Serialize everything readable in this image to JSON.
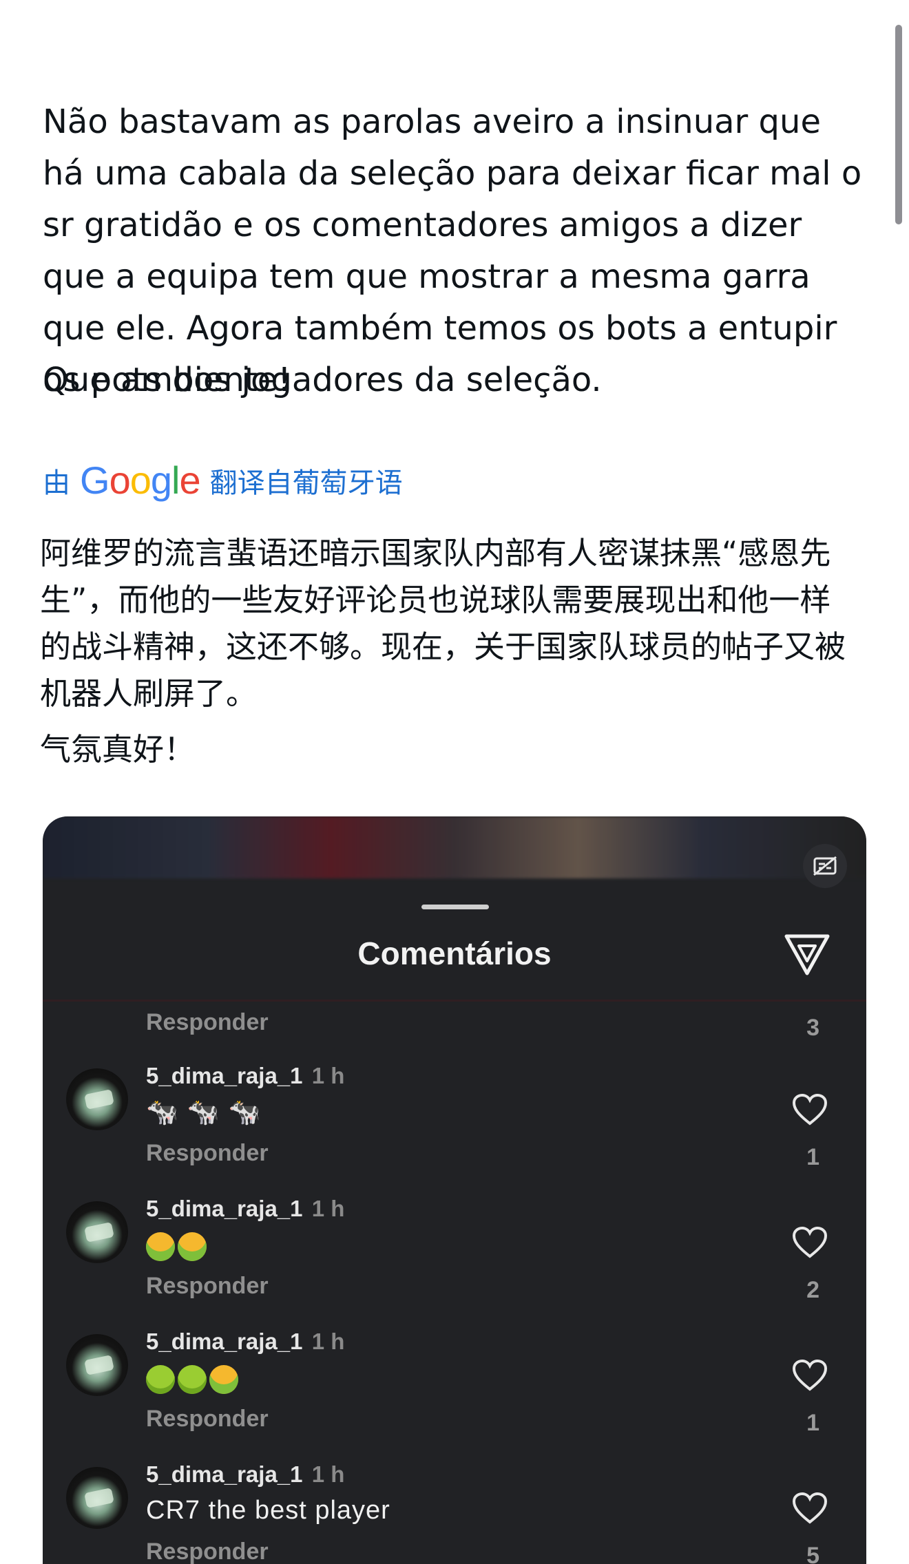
{
  "post": {
    "paragraph": "Não bastavam as parolas aveiro a insinuar que há uma cabala da seleção para deixar ficar mal o sr gratidão e os comentadores amigos a dizer que a equipa tem que mostrar a mesma garra que ele. Agora também temos os bots a entupir os pots dos jogadores da seleção.",
    "closing": "Que ambiente!"
  },
  "translation": {
    "prefix": "由",
    "brand": [
      "G",
      "o",
      "o",
      "g",
      "l",
      "e"
    ],
    "suffix": "翻译自葡萄牙语",
    "paragraph": "阿维罗的流言蜚语还暗示国家队内部有人密谋抹黑“感恩先生”，而他的一些友好评论员也说球队需要展现出和他一样的战斗精神，这还不够。现在，关于国家队球员的帖子又被机器人刷屏了。",
    "closing": "气氛真好！"
  },
  "media": {
    "sheet_title": "Comentários",
    "first_reply_label": "Responder",
    "first_count": "3",
    "comments": [
      {
        "user": "5_dima_raja_1",
        "time": "1 h",
        "text": "🐄 🐄 🐄",
        "reply": "Responder",
        "likes": "1"
      },
      {
        "user": "5_dima_raja_1",
        "time": "1 h",
        "text": "",
        "reply": "Responder",
        "likes": "2"
      },
      {
        "user": "5_dima_raja_1",
        "time": "1 h",
        "text": "",
        "reply": "Responder",
        "likes": "1"
      },
      {
        "user": "5_dima_raja_1",
        "time": "1 h",
        "text": "CR7 the best player",
        "reply": "Responder",
        "likes": "5"
      }
    ]
  }
}
